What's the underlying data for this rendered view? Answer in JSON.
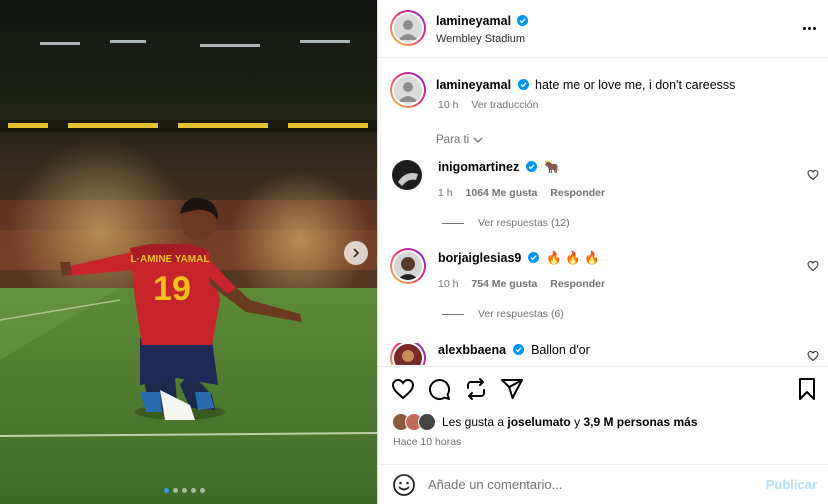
{
  "post": {
    "username": "lamineyamal",
    "location": "Wembley Stadium",
    "caption": "hate me or love me, i don't careesss",
    "time": "10 h",
    "translate": "Ver traducción",
    "carousel": {
      "slides": 5,
      "active": 0
    }
  },
  "sort_label": "Para ti",
  "comments": [
    {
      "username": "inigomartinez",
      "text": "🐂",
      "time": "1 h",
      "likes": "1064 Me gusta",
      "reply": "Responder",
      "replies": "Ver respuestas (12)"
    },
    {
      "username": "borjaiglesias9",
      "text": "🔥 🔥 🔥",
      "time": "10 h",
      "likes": "754 Me gusta",
      "reply": "Responder",
      "replies": "Ver respuestas (6)"
    },
    {
      "username": "alexbbaena",
      "text": "Ballon d'or"
    }
  ],
  "likes_line": {
    "prefix": "Les gusta a",
    "user": "joselumato",
    "connector": "y",
    "others": "3,9 M personas más"
  },
  "posted_ago": "Hace 10 horas",
  "add_comment": {
    "placeholder": "Añade un comentario...",
    "post_label": "Publicar"
  },
  "icons": [
    "more-options-icon",
    "verified-icon",
    "heart-icon",
    "comment-icon",
    "share-icon",
    "send-icon",
    "save-icon",
    "emoji-icon",
    "chevron-down-icon",
    "chevron-right-icon"
  ],
  "colors": {
    "verified": "#0095f6",
    "muted": "#737373",
    "publish_disabled": "#b2dffc",
    "jersey_red": "#c8242c",
    "jersey_yellow": "#f2c21b"
  }
}
